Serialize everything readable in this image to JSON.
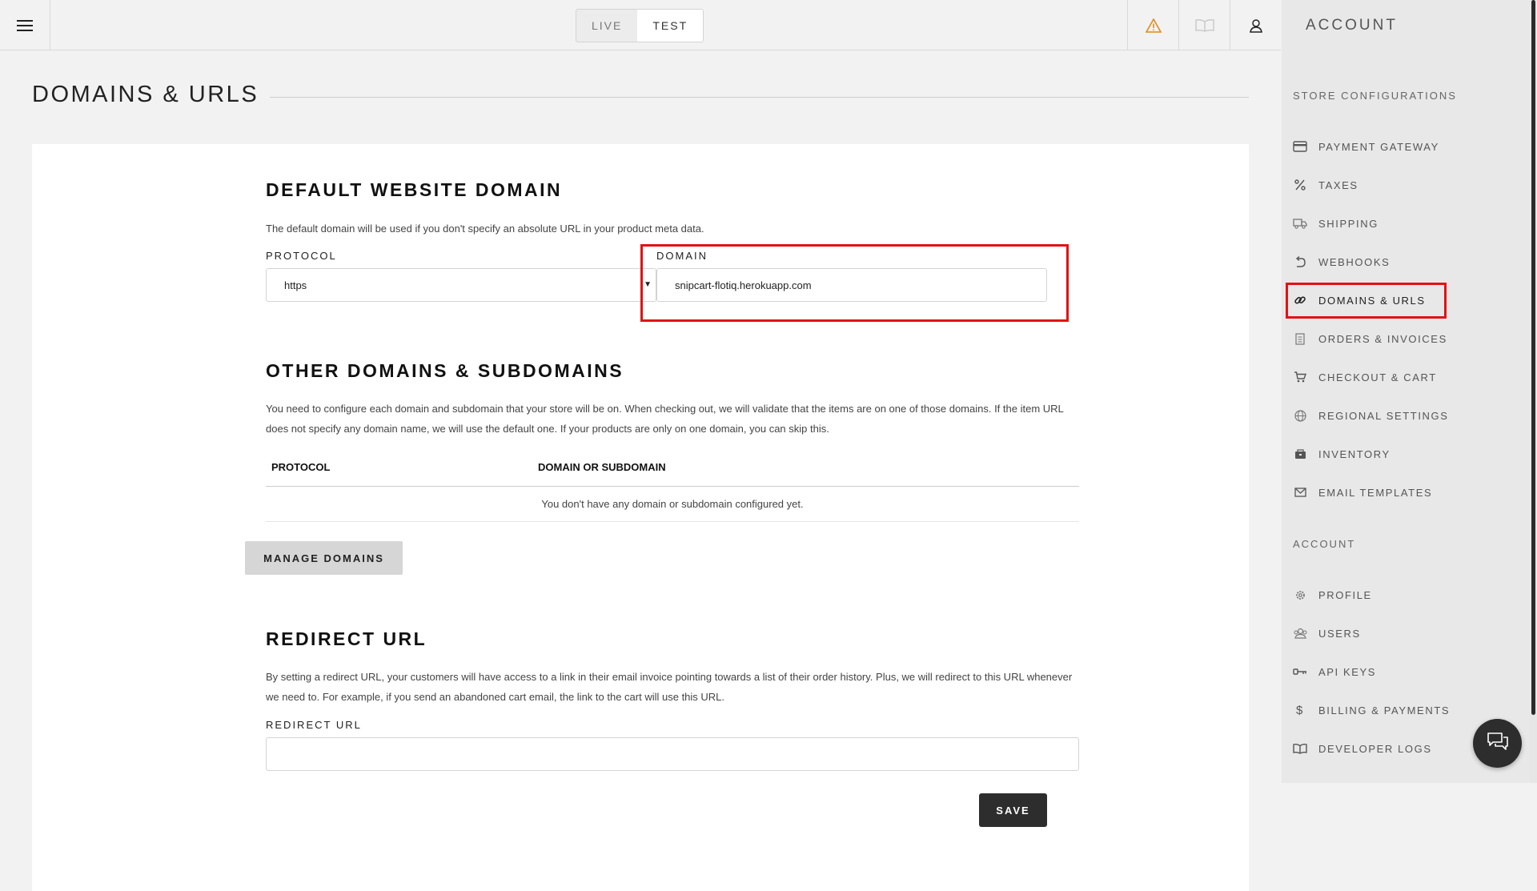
{
  "topbar": {
    "modes": [
      {
        "label": "LIVE",
        "active": false
      },
      {
        "label": "TEST",
        "active": true
      }
    ],
    "icons": [
      "hamburger-menu-icon",
      "warning-icon",
      "book-icon",
      "user-icon"
    ]
  },
  "page": {
    "title": "DOMAINS & URLS"
  },
  "default_domain": {
    "heading": "DEFAULT WEBSITE DOMAIN",
    "description": "The default domain will be used if you don't specify an absolute URL in your product meta data.",
    "protocol_label": "PROTOCOL",
    "protocol_value": "https",
    "domain_label": "DOMAIN",
    "domain_value": "snipcart-flotiq.herokuapp.com"
  },
  "other_domains": {
    "heading": "OTHER DOMAINS & SUBDOMAINS",
    "description": "You need to configure each domain and subdomain that your store will be on. When checking out, we will validate that the items are on one of those domains. If the item URL does not specify any domain name, we will use the default one. If your products are only on one domain, you can skip this.",
    "columns": [
      "PROTOCOL",
      "DOMAIN OR SUBDOMAIN"
    ],
    "empty_message": "You don't have any domain or subdomain configured yet.",
    "manage_button": "MANAGE DOMAINS"
  },
  "redirect": {
    "heading": "REDIRECT URL",
    "description": "By setting a redirect URL, your customers will have access to a link in their email invoice pointing towards a list of their order history. Plus, we will redirect to this URL whenever we need to. For example, if you send an abandoned cart email, the link to the cart will use this URL.",
    "label": "REDIRECT URL",
    "value": "",
    "save_button": "SAVE"
  },
  "sidebar": {
    "header": "ACCOUNT",
    "store_section_label": "STORE CONFIGURATIONS",
    "store_items": [
      {
        "label": "PAYMENT GATEWAY",
        "icon": "credit-card-icon",
        "active": false
      },
      {
        "label": "TAXES",
        "icon": "percent-icon",
        "active": false
      },
      {
        "label": "SHIPPING",
        "icon": "truck-icon",
        "active": false
      },
      {
        "label": "WEBHOOKS",
        "icon": "undo-arrow-icon",
        "active": false
      },
      {
        "label": "DOMAINS & URLS",
        "icon": "link-icon",
        "active": true
      },
      {
        "label": "ORDERS & INVOICES",
        "icon": "receipt-icon",
        "active": false
      },
      {
        "label": "CHECKOUT & CART",
        "icon": "cart-icon",
        "active": false
      },
      {
        "label": "REGIONAL SETTINGS",
        "icon": "globe-icon",
        "active": false
      },
      {
        "label": "INVENTORY",
        "icon": "box-icon",
        "active": false
      },
      {
        "label": "EMAIL TEMPLATES",
        "icon": "envelope-icon",
        "active": false
      }
    ],
    "account_section_label": "ACCOUNT",
    "account_items": [
      {
        "label": "PROFILE",
        "icon": "gear-icon"
      },
      {
        "label": "USERS",
        "icon": "users-icon"
      },
      {
        "label": "API KEYS",
        "icon": "key-icon"
      },
      {
        "label": "BILLING & PAYMENTS",
        "icon": "dollar-icon"
      },
      {
        "label": "DEVELOPER LOGS",
        "icon": "book-icon"
      }
    ]
  },
  "colors": {
    "highlight": "#e01313",
    "dark_button": "#2d2d2d",
    "warning": "#e08a1e"
  }
}
